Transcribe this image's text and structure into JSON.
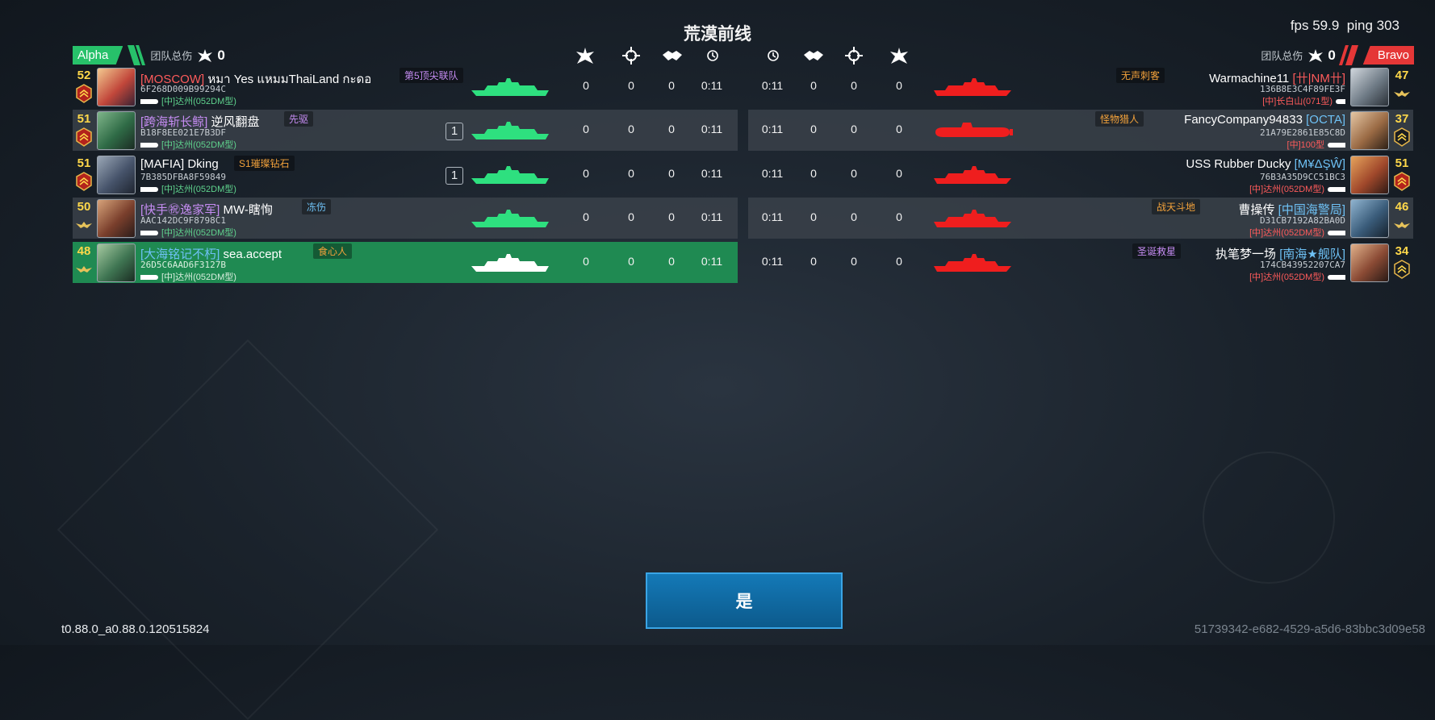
{
  "title": "荒漠前线",
  "fps": "fps 59.9",
  "ping": "ping 303",
  "team_left": {
    "tag": "Alpha",
    "damage_label": "团队总伤",
    "damage": "0",
    "color": "#27c16a"
  },
  "team_right": {
    "tag": "Bravo",
    "damage_label": "团队总伤",
    "damage": "0",
    "color": "#e53737"
  },
  "column_icons": [
    "kill-icon",
    "crosshair-icon",
    "handshake-icon",
    "clock-icon"
  ],
  "alpha_players": [
    {
      "level": "52",
      "clan": "[MOSCOW]",
      "name": " หมา Yes แหมมThaiLand กะดอ",
      "tag": "第5顶尖联队",
      "id": "6F268D009B99294C",
      "ship": "[中]达州(052DM型)",
      "count": "",
      "stats": [
        "0",
        "0",
        "0",
        "0:11"
      ]
    },
    {
      "level": "51",
      "clan": "[跨海斩长鲸]",
      "name": " 逆风翻盘",
      "tag": "先驱",
      "id": "B18F8EE021E7B3DF",
      "ship": "[中]达州(052DM型)",
      "count": "1",
      "stats": [
        "0",
        "0",
        "0",
        "0:11"
      ]
    },
    {
      "level": "51",
      "clan": "[MAFIA]",
      "name": " Dking",
      "tag": "S1璀璨钻石",
      "id": "7B385DFBA8F59849",
      "ship": "[中]达州(052DM型)",
      "count": "1",
      "stats": [
        "0",
        "0",
        "0",
        "0:11"
      ]
    },
    {
      "level": "50",
      "clan": "[快手㊗逸家军]",
      "name": " MW-瞎恂",
      "tag": "冻伤",
      "id": "AAC142DC9F8798C1",
      "ship": "[中]达州(052DM型)",
      "count": "",
      "stats": [
        "0",
        "0",
        "0",
        "0:11"
      ]
    },
    {
      "level": "48",
      "clan": "[大海铭记不朽]",
      "name": " sea.accept",
      "tag": "食心人",
      "id": "26D5C6AAD6F3127B",
      "ship": "[中]达州(052DM型)",
      "count": "",
      "stats": [
        "0",
        "0",
        "0",
        "0:11"
      ]
    }
  ],
  "bravo_players": [
    {
      "level": "47",
      "name": "Warmachine11 ",
      "clan": "[卄|NM卄]",
      "tag": "无声刺客",
      "id": "136B8E3C4F89FE3F",
      "ship": "[中]长白山(071型)",
      "stats": [
        "0:11",
        "0",
        "0",
        "0"
      ]
    },
    {
      "level": "37",
      "name": "FancyCompany94833 ",
      "clan": "[OCTA]",
      "tag": "怪物猎人",
      "id": "21A79E2861E85C8D",
      "ship": "[中]100型",
      "stats": [
        "0:11",
        "0",
        "0",
        "0"
      ]
    },
    {
      "level": "51",
      "name": "USS Rubber Ducky ",
      "clan": "[M¥ΔŞŴ]",
      "tag": "",
      "id": "76B3A35D9CC51BC3",
      "ship": "[中]达州(052DM型)",
      "stats": [
        "0:11",
        "0",
        "0",
        "0"
      ]
    },
    {
      "level": "46",
      "name": "曹操传 ",
      "clan": "[中国海警局]",
      "tag": "战天斗地",
      "id": "D31CB7192A82BA0D",
      "ship": "[中]达州(052DM型)",
      "stats": [
        "0:11",
        "0",
        "0",
        "0"
      ]
    },
    {
      "level": "34",
      "name": "执笔梦一场 ",
      "clan": "[南海★舰队]",
      "tag": "圣诞救星",
      "id": "174CB43952207CA7",
      "ship": "[中]达州(052DM型)",
      "stats": [
        "0:11",
        "0",
        "0",
        "0"
      ]
    }
  ],
  "confirm_button": "是",
  "version": "t0.88.0_a0.88.0.120515824",
  "session_id": "51739342-e682-4529-a5d6-83bbc3d09e58"
}
